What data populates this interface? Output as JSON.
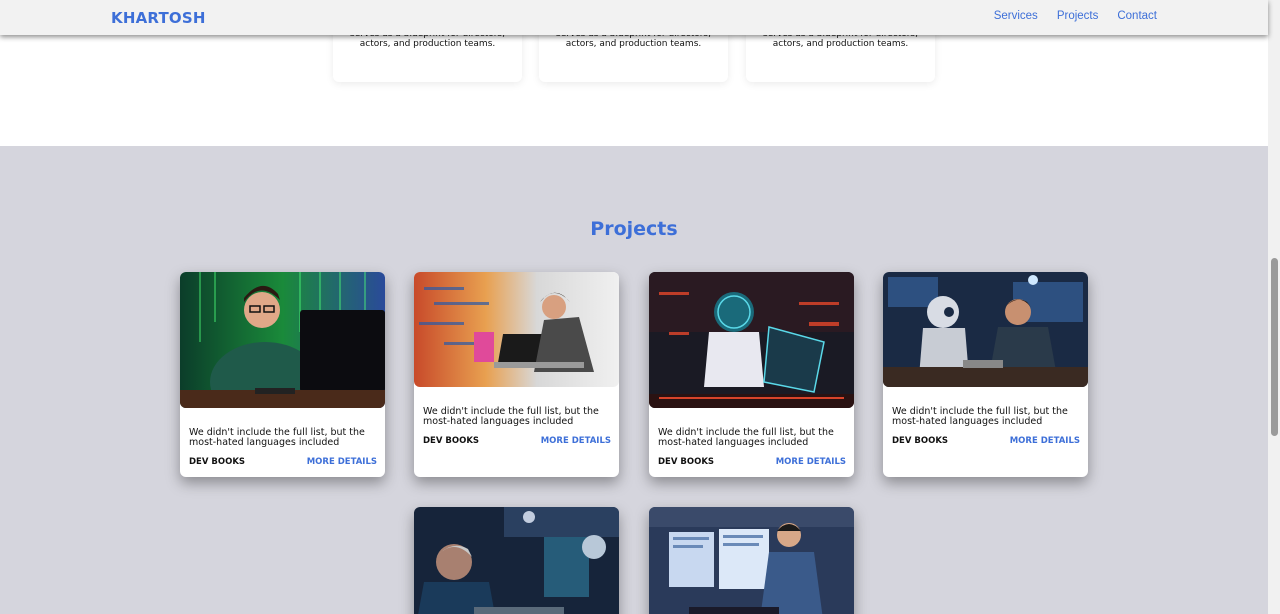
{
  "nav": {
    "brand": "KHARTOSH",
    "links": [
      "Services",
      "Projects",
      "Contact"
    ]
  },
  "services": {
    "cards": [
      {
        "text": "serves as a blueprint for directors, actors, and production teams."
      },
      {
        "text": "serves as a blueprint for directors, actors, and production teams."
      },
      {
        "text": "serves as a blueprint for directors, actors, and production teams."
      }
    ]
  },
  "projects": {
    "title": "Projects",
    "cards": [
      {
        "desc": "We didn't include the full list, but the most-hated languages included",
        "tag": "DEV BOOKS",
        "more": "MORE DETAILS"
      },
      {
        "desc": "We didn't include the full list, but the most-hated languages included",
        "tag": "DEV BOOKS",
        "more": "MORE DETAILS"
      },
      {
        "desc": "We didn't include the full list, but the most-hated languages included",
        "tag": "DEV BOOKS",
        "more": "MORE DETAILS"
      },
      {
        "desc": "We didn't include the full list, but the most-hated languages included",
        "tag": "DEV BOOKS",
        "more": "MORE DETAILS"
      }
    ]
  },
  "colors": {
    "accent": "#3d6fd8",
    "section_bg": "#d5d5dd"
  }
}
